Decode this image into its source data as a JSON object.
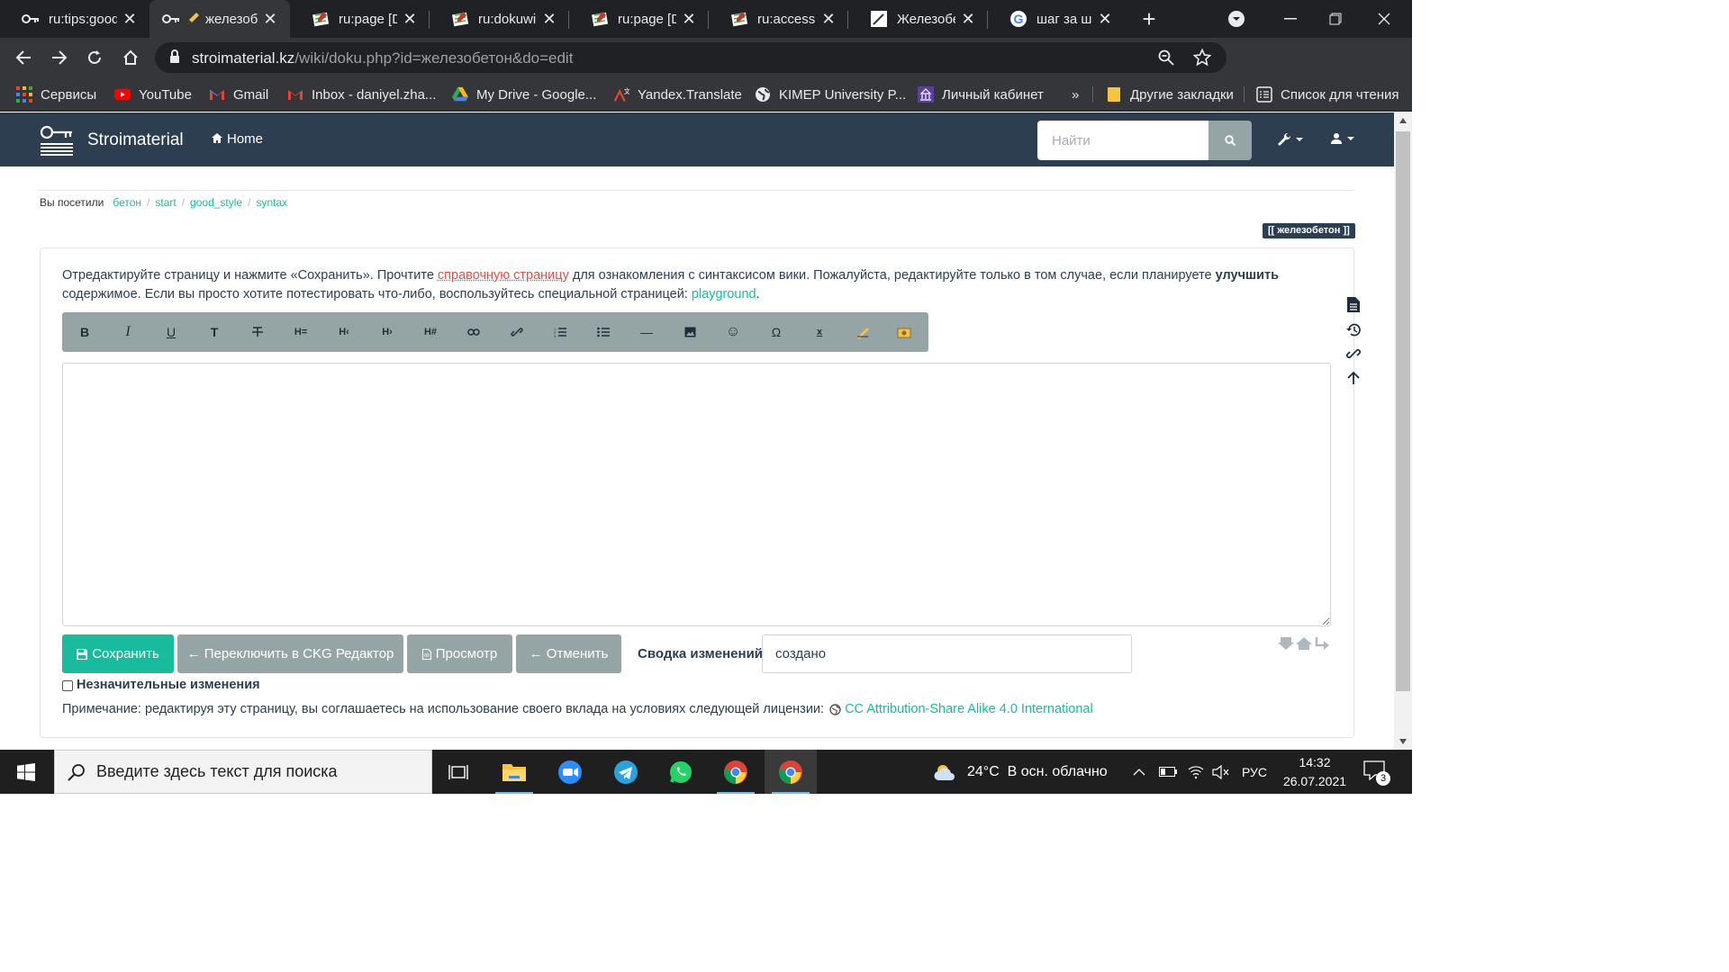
{
  "browser": {
    "tabs": [
      {
        "title": "ru:tips:good",
        "icon": "dokuwiki-key-icon",
        "active": false
      },
      {
        "title": "железобетон",
        "icon": "pencil-icon",
        "active": true
      },
      {
        "title": "ru:page [Do",
        "icon": "dokuwiki-icon",
        "active": false
      },
      {
        "title": "ru:dokuwiki",
        "icon": "dokuwiki-icon",
        "active": false
      },
      {
        "title": "ru:page [Do",
        "icon": "dokuwiki-icon",
        "active": false
      },
      {
        "title": "ru:accesskey",
        "icon": "dokuwiki-icon",
        "active": false
      },
      {
        "title": "Железобетон",
        "icon": "wiki-edit-icon",
        "active": false
      },
      {
        "title": "шаг за шаг",
        "icon": "google-icon",
        "active": false
      }
    ],
    "address": {
      "domain": "stroimaterial.kz",
      "path": "/wiki/doku.php?id=железобетон&do=edit"
    },
    "bookmarks": [
      {
        "label": "Сервисы",
        "icon": "apps-grid-icon"
      },
      {
        "label": "YouTube",
        "icon": "youtube-icon"
      },
      {
        "label": "Gmail",
        "icon": "gmail-icon"
      },
      {
        "label": "Inbox - daniyel.zha...",
        "icon": "gmail-icon"
      },
      {
        "label": "My Drive - Google...",
        "icon": "google-drive-icon"
      },
      {
        "label": "Yandex.Translate",
        "icon": "yandex-translate-icon"
      },
      {
        "label": "KIMEP University P...",
        "icon": "globe-icon"
      },
      {
        "label": "Личный кабинет",
        "icon": "building-icon"
      }
    ],
    "bookmarks_more": "»",
    "other_bookmarks": "Другие закладки",
    "reading_list": "Список для чтения"
  },
  "site": {
    "brand": "Stroimaterial",
    "home": "Home",
    "search_placeholder": "Найти"
  },
  "breadcrumbs": {
    "label": "Вы посетили",
    "items": [
      "бетон",
      "start",
      "good_style",
      "syntax"
    ]
  },
  "page_id": "[[ железобетон ]]",
  "intro": {
    "part1": "Отредактируйте страницу и нажмите «Сохранить». Прочтите ",
    "help_link": "справочную страницу",
    "part2": " для ознакомления с синтаксисом вики. Пожалуйста, редактируйте только в том случае, если планируете ",
    "improve": "улучшить",
    "part3": " содержимое. Если вы просто хотите потестировать что-либо, воспользуйтесь специальной страницей: ",
    "playground": "playground",
    "part4": "."
  },
  "editor_toolbar": [
    {
      "glyph": "B",
      "name": "bold-button"
    },
    {
      "glyph": "I",
      "name": "italic-button"
    },
    {
      "glyph": "U",
      "name": "underline-button"
    },
    {
      "glyph": "T",
      "name": "monospace-button"
    },
    {
      "glyph": "S",
      "name": "strikethrough-button"
    },
    {
      "glyph": "H=",
      "name": "same-level-heading-button"
    },
    {
      "glyph": "H‹",
      "name": "higher-heading-button"
    },
    {
      "glyph": "H›",
      "name": "lower-heading-button"
    },
    {
      "glyph": "H#",
      "name": "select-heading-button"
    },
    {
      "glyph": "",
      "name": "internal-link-button"
    },
    {
      "glyph": "",
      "name": "external-link-button"
    },
    {
      "glyph": "",
      "name": "ordered-list-button"
    },
    {
      "glyph": "",
      "name": "unordered-list-button"
    },
    {
      "glyph": "—",
      "name": "horizontal-rule-button"
    },
    {
      "glyph": "",
      "name": "add-image-button"
    },
    {
      "glyph": "☺",
      "name": "smileys-button"
    },
    {
      "glyph": "Ω",
      "name": "special-chars-button"
    },
    {
      "glyph": "x",
      "name": "subscript-button"
    },
    {
      "glyph": "",
      "name": "signature-button"
    },
    {
      "glyph": "",
      "name": "plugin-button"
    }
  ],
  "editor_text": "",
  "buttons": {
    "save": "Сохранить",
    "switch_ckg": "← Переключить в CKG Редактор",
    "preview": "Просмотр",
    "cancel": "← Отменить"
  },
  "summary": {
    "label": "Сводка изменений",
    "value": "создано"
  },
  "minor_changes": "Незначительные изменения",
  "license": {
    "text": "Примечание: редактируя эту страницу, вы соглашаетесь на использование своего вклада на условиях следующей лицензии:",
    "link": "CC Attribution-Share Alike 4.0 International"
  },
  "taskbar": {
    "search_placeholder": "Введите здесь текст для поиска",
    "weather": "24°C  В осн. облачно",
    "lang": "РУС",
    "time": "14:32",
    "date": "26.07.2021",
    "notifications": "3"
  },
  "colors": {
    "navbar": "#2c3e50",
    "accent": "#18bc9c",
    "grey_button": "#95a5a6",
    "chrome_dark": "#202124"
  }
}
